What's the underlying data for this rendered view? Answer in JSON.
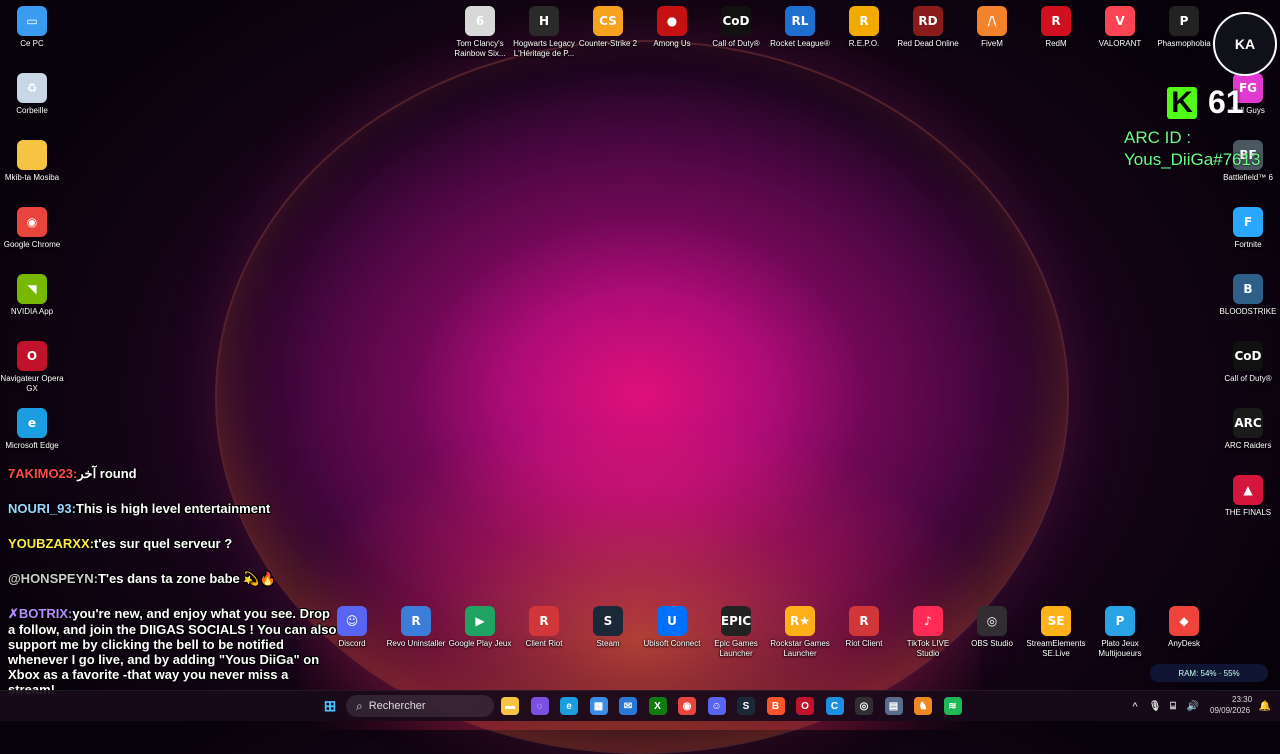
{
  "desktop": {
    "left_column": [
      {
        "label": "Ce PC",
        "icon": "computer-icon",
        "color": "#3a9cf0",
        "glyph": "▭"
      },
      {
        "label": "Corbeille",
        "icon": "recycle-bin-icon",
        "color": "#c9d6e6",
        "glyph": "♻"
      },
      {
        "label": "Mkib-ta Mosiba",
        "icon": "folder-icon",
        "color": "#f6c343",
        "glyph": ""
      },
      {
        "label": "Google Chrome",
        "icon": "chrome-icon",
        "color": "#e8453c",
        "glyph": "◉"
      },
      {
        "label": "NVIDIA App",
        "icon": "nvidia-icon",
        "color": "#76b900",
        "glyph": "◥"
      },
      {
        "label": "Navigateur Opera GX",
        "icon": "opera-gx-icon",
        "color": "#c0122a",
        "glyph": "O"
      },
      {
        "label": "Microsoft Edge",
        "icon": "edge-icon",
        "color": "#1b9de2",
        "glyph": "e"
      }
    ],
    "top_row": [
      {
        "label": "Tom Clancy's Rainbow Six...",
        "icon": "rainbow-six-icon",
        "color": "#d8d8d8",
        "glyph": "6"
      },
      {
        "label": "Hogwarts Legacy L'Héritage de P...",
        "icon": "hogwarts-icon",
        "color": "#2a2a2a",
        "glyph": "H"
      },
      {
        "label": "Counter-Strike 2",
        "icon": "counter-strike-icon",
        "color": "#f6a21e",
        "glyph": "CS"
      },
      {
        "label": "Among Us",
        "icon": "among-us-icon",
        "color": "#c51111",
        "glyph": "●"
      },
      {
        "label": "Call of Duty®",
        "icon": "call-of-duty-icon",
        "color": "#111111",
        "glyph": "CoD"
      },
      {
        "label": "Rocket League®",
        "icon": "rocket-league-icon",
        "color": "#1f6fd1",
        "glyph": "RL"
      },
      {
        "label": "R.E.P.O.",
        "icon": "repo-icon",
        "color": "#f2a900",
        "glyph": "R"
      },
      {
        "label": "Red Dead Online",
        "icon": "red-dead-icon",
        "color": "#8b1a1a",
        "glyph": "RD"
      },
      {
        "label": "FiveM",
        "icon": "fivem-icon",
        "color": "#f4822a",
        "glyph": "/\\"
      },
      {
        "label": "RedM",
        "icon": "redm-icon",
        "color": "#d0101e",
        "glyph": "R"
      },
      {
        "label": "VALORANT",
        "icon": "valorant-icon",
        "color": "#fa4454",
        "glyph": "V"
      },
      {
        "label": "Phasmophobia",
        "icon": "phasmophobia-icon",
        "color": "#222222",
        "glyph": "P"
      }
    ],
    "right_column": [
      {
        "label": "Fall Guys",
        "icon": "fall-guys-icon",
        "color": "#e23ad0",
        "glyph": "FG"
      },
      {
        "label": "Battlefield™ 6",
        "icon": "battlefield-icon",
        "color": "#4a5660",
        "glyph": "BF"
      },
      {
        "label": "Fortnite",
        "icon": "fortnite-icon",
        "color": "#2aa7ff",
        "glyph": "F"
      },
      {
        "label": "BLOODSTRIKE",
        "icon": "bloodstrike-icon",
        "color": "#2e5f88",
        "glyph": "B"
      },
      {
        "label": "Call of Duty®",
        "icon": "call-of-duty-icon",
        "color": "#111111",
        "glyph": "CoD"
      },
      {
        "label": "ARC Raiders",
        "icon": "arc-raiders-icon",
        "color": "#1a1a1a",
        "glyph": "ARC"
      },
      {
        "label": "THE FINALS",
        "icon": "the-finals-icon",
        "color": "#d4163c",
        "glyph": "▲"
      }
    ],
    "bottom_row": [
      {
        "label": "Discord",
        "icon": "discord-icon",
        "color": "#5865f2",
        "glyph": "☺"
      },
      {
        "label": "Revo Uninstaller",
        "icon": "revo-uninstaller-icon",
        "color": "#3b7dd8",
        "glyph": "R"
      },
      {
        "label": "Google Play Jeux",
        "icon": "google-play-games-icon",
        "color": "#1ea362",
        "glyph": "▶"
      },
      {
        "label": "Client Riot",
        "icon": "riot-client-icon",
        "color": "#d13639",
        "glyph": "R"
      },
      {
        "label": "Steam",
        "icon": "steam-icon",
        "color": "#1b2838",
        "glyph": "S"
      },
      {
        "label": "Ubisoft Connect",
        "icon": "ubisoft-icon",
        "color": "#0070ff",
        "glyph": "U"
      },
      {
        "label": "Epic Games Launcher",
        "icon": "epic-games-icon",
        "color": "#222222",
        "glyph": "EPIC"
      },
      {
        "label": "Rockstar Games Launcher",
        "icon": "rockstar-icon",
        "color": "#fcaf17",
        "glyph": "R★"
      },
      {
        "label": "Riot Client",
        "icon": "riot-client-icon",
        "color": "#d13639",
        "glyph": "R"
      },
      {
        "label": "TikTok LIVE Studio",
        "icon": "tiktok-icon",
        "color": "#ff2a55",
        "glyph": "♪"
      },
      {
        "label": "OBS Studio",
        "icon": "obs-icon",
        "color": "#302e31",
        "glyph": "◎"
      },
      {
        "label": "StreamElements SE.Live",
        "icon": "streamelements-icon",
        "color": "#ffb11a",
        "glyph": "SE"
      },
      {
        "label": "Plato Jeux Multijoueurs",
        "icon": "plato-icon",
        "color": "#29a3e6",
        "glyph": "P"
      },
      {
        "label": "AnyDesk",
        "icon": "anydesk-icon",
        "color": "#ef443b",
        "glyph": "◆"
      }
    ]
  },
  "overlay": {
    "kick_letter": "K",
    "kick_viewers": "61",
    "arc_id_line1": "ARC ID :",
    "arc_id_line2": "Yous_DiiGa#7613",
    "logo_text": "KA",
    "chat": [
      {
        "user": "7AKIMO23:",
        "user_color": "red",
        "message": "آخر round"
      },
      {
        "user": "NOURI_93:",
        "user_color": "",
        "message": "This is high level entertainment"
      },
      {
        "user": "YOUBZARXX:",
        "user_color": "yellow",
        "message": "t'es sur quel serveur ?"
      },
      {
        "user": "@HONSPEYN:",
        "user_color": "gray",
        "message": "T'es dans ta zone babe 💫🔥"
      },
      {
        "user": "✗BOTRIX:",
        "user_color": "violet",
        "message": "you're new, and enjoy what you see. Drop a follow, and join the DIIGAS SOCIALS ! You can also support me by clicking the bell to be notified whenever I go live, and by adding \"Yous DiiGa\" on Xbox as a favorite -that way you never miss a stream!"
      }
    ]
  },
  "taskbar": {
    "search_placeholder": "Rechercher",
    "pinned": [
      {
        "name": "file-explorer-icon",
        "color": "#f6c343",
        "glyph": "▬"
      },
      {
        "name": "copilot-icon",
        "color": "#7b4fe0",
        "glyph": "◌"
      },
      {
        "name": "edge-icon",
        "color": "#1b9de2",
        "glyph": "e"
      },
      {
        "name": "store-icon",
        "color": "#3c8ce7",
        "glyph": "▦"
      },
      {
        "name": "mail-icon",
        "color": "#2a78d6",
        "glyph": "✉"
      },
      {
        "name": "xbox-icon",
        "color": "#107c10",
        "glyph": "X"
      },
      {
        "name": "chrome-icon",
        "color": "#e8453c",
        "glyph": "◉"
      },
      {
        "name": "discord-icon",
        "color": "#5865f2",
        "glyph": "☺"
      },
      {
        "name": "steam-icon",
        "color": "#1b2838",
        "glyph": "S"
      },
      {
        "name": "brave-icon",
        "color": "#fb542b",
        "glyph": "B"
      },
      {
        "name": "opera-gx-icon",
        "color": "#c0122a",
        "glyph": "O"
      },
      {
        "name": "ccleaner-icon",
        "color": "#1d8fe0",
        "glyph": "C"
      },
      {
        "name": "obs-icon",
        "color": "#302e31",
        "glyph": "◎"
      },
      {
        "name": "task-manager-icon",
        "color": "#5a6b8c",
        "glyph": "▤"
      },
      {
        "name": "game-icon",
        "color": "#ee8822",
        "glyph": "♞"
      },
      {
        "name": "spotify-icon",
        "color": "#1db954",
        "glyph": "≋"
      }
    ],
    "ram_text": "RAM: 54% · 55%",
    "time": "23:30",
    "date": "09/09/2026"
  }
}
